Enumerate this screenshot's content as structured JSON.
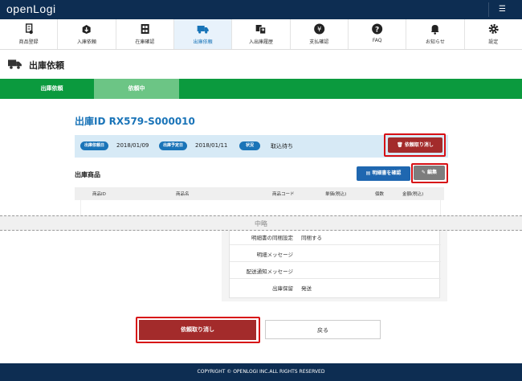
{
  "app": {
    "logo": "openLogi",
    "menu_icon": "list-icon"
  },
  "nav": [
    {
      "label": "商品登録",
      "icon": "product-register-icon"
    },
    {
      "label": "入庫依頼",
      "icon": "inbound-box-icon"
    },
    {
      "label": "在庫確認",
      "icon": "inventory-icon"
    },
    {
      "label": "出庫依頼",
      "icon": "truck-icon",
      "active": true
    },
    {
      "label": "入出庫履歴",
      "icon": "history-icon"
    },
    {
      "label": "支払確認",
      "icon": "yen-icon"
    },
    {
      "label": "FAQ",
      "icon": "question-icon"
    },
    {
      "label": "お知らせ",
      "icon": "bell-icon"
    },
    {
      "label": "設定",
      "icon": "gear-icon"
    }
  ],
  "page": {
    "title": "出庫依頼",
    "icon": "truck-icon"
  },
  "steps": [
    "出庫依頼",
    "依頼中"
  ],
  "request": {
    "id": "出庫ID RX579-S000010",
    "req_date_label": "出庫依頼日",
    "req_date": "2018/01/09",
    "plan_date_label": "出庫予定日",
    "plan_date": "2018/01/11",
    "status_label": "状況",
    "status": "取込待ち",
    "cancel_label": "依頼取り消し"
  },
  "products": {
    "title": "出庫商品",
    "spec_button": "明細書を確認",
    "edit_button": "編集",
    "columns": [
      "商品ID",
      "商品名",
      "商品コード",
      "単価(税込)",
      "個数",
      "金額(税込)"
    ]
  },
  "omitted_label": "中略",
  "details": [
    {
      "label": "明細書の同梱設定",
      "value": "同梱する"
    },
    {
      "label": "明細メッセージ",
      "value": ""
    },
    {
      "label": "配送通知メッセージ",
      "value": ""
    },
    {
      "label": "出庫保留",
      "value": "発送"
    }
  ],
  "actions": {
    "cancel": "依頼取り消し",
    "back": "戻る"
  },
  "footer": "COPYRIGHT © OPENLOGI INC.ALL RIGHTS RESERVED",
  "colors": {
    "navy": "#0d2d52",
    "green": "#0b9a3e",
    "blue": "#1a74b8",
    "cancel_red": "#a32b2b",
    "highlight": "#d70f14"
  }
}
